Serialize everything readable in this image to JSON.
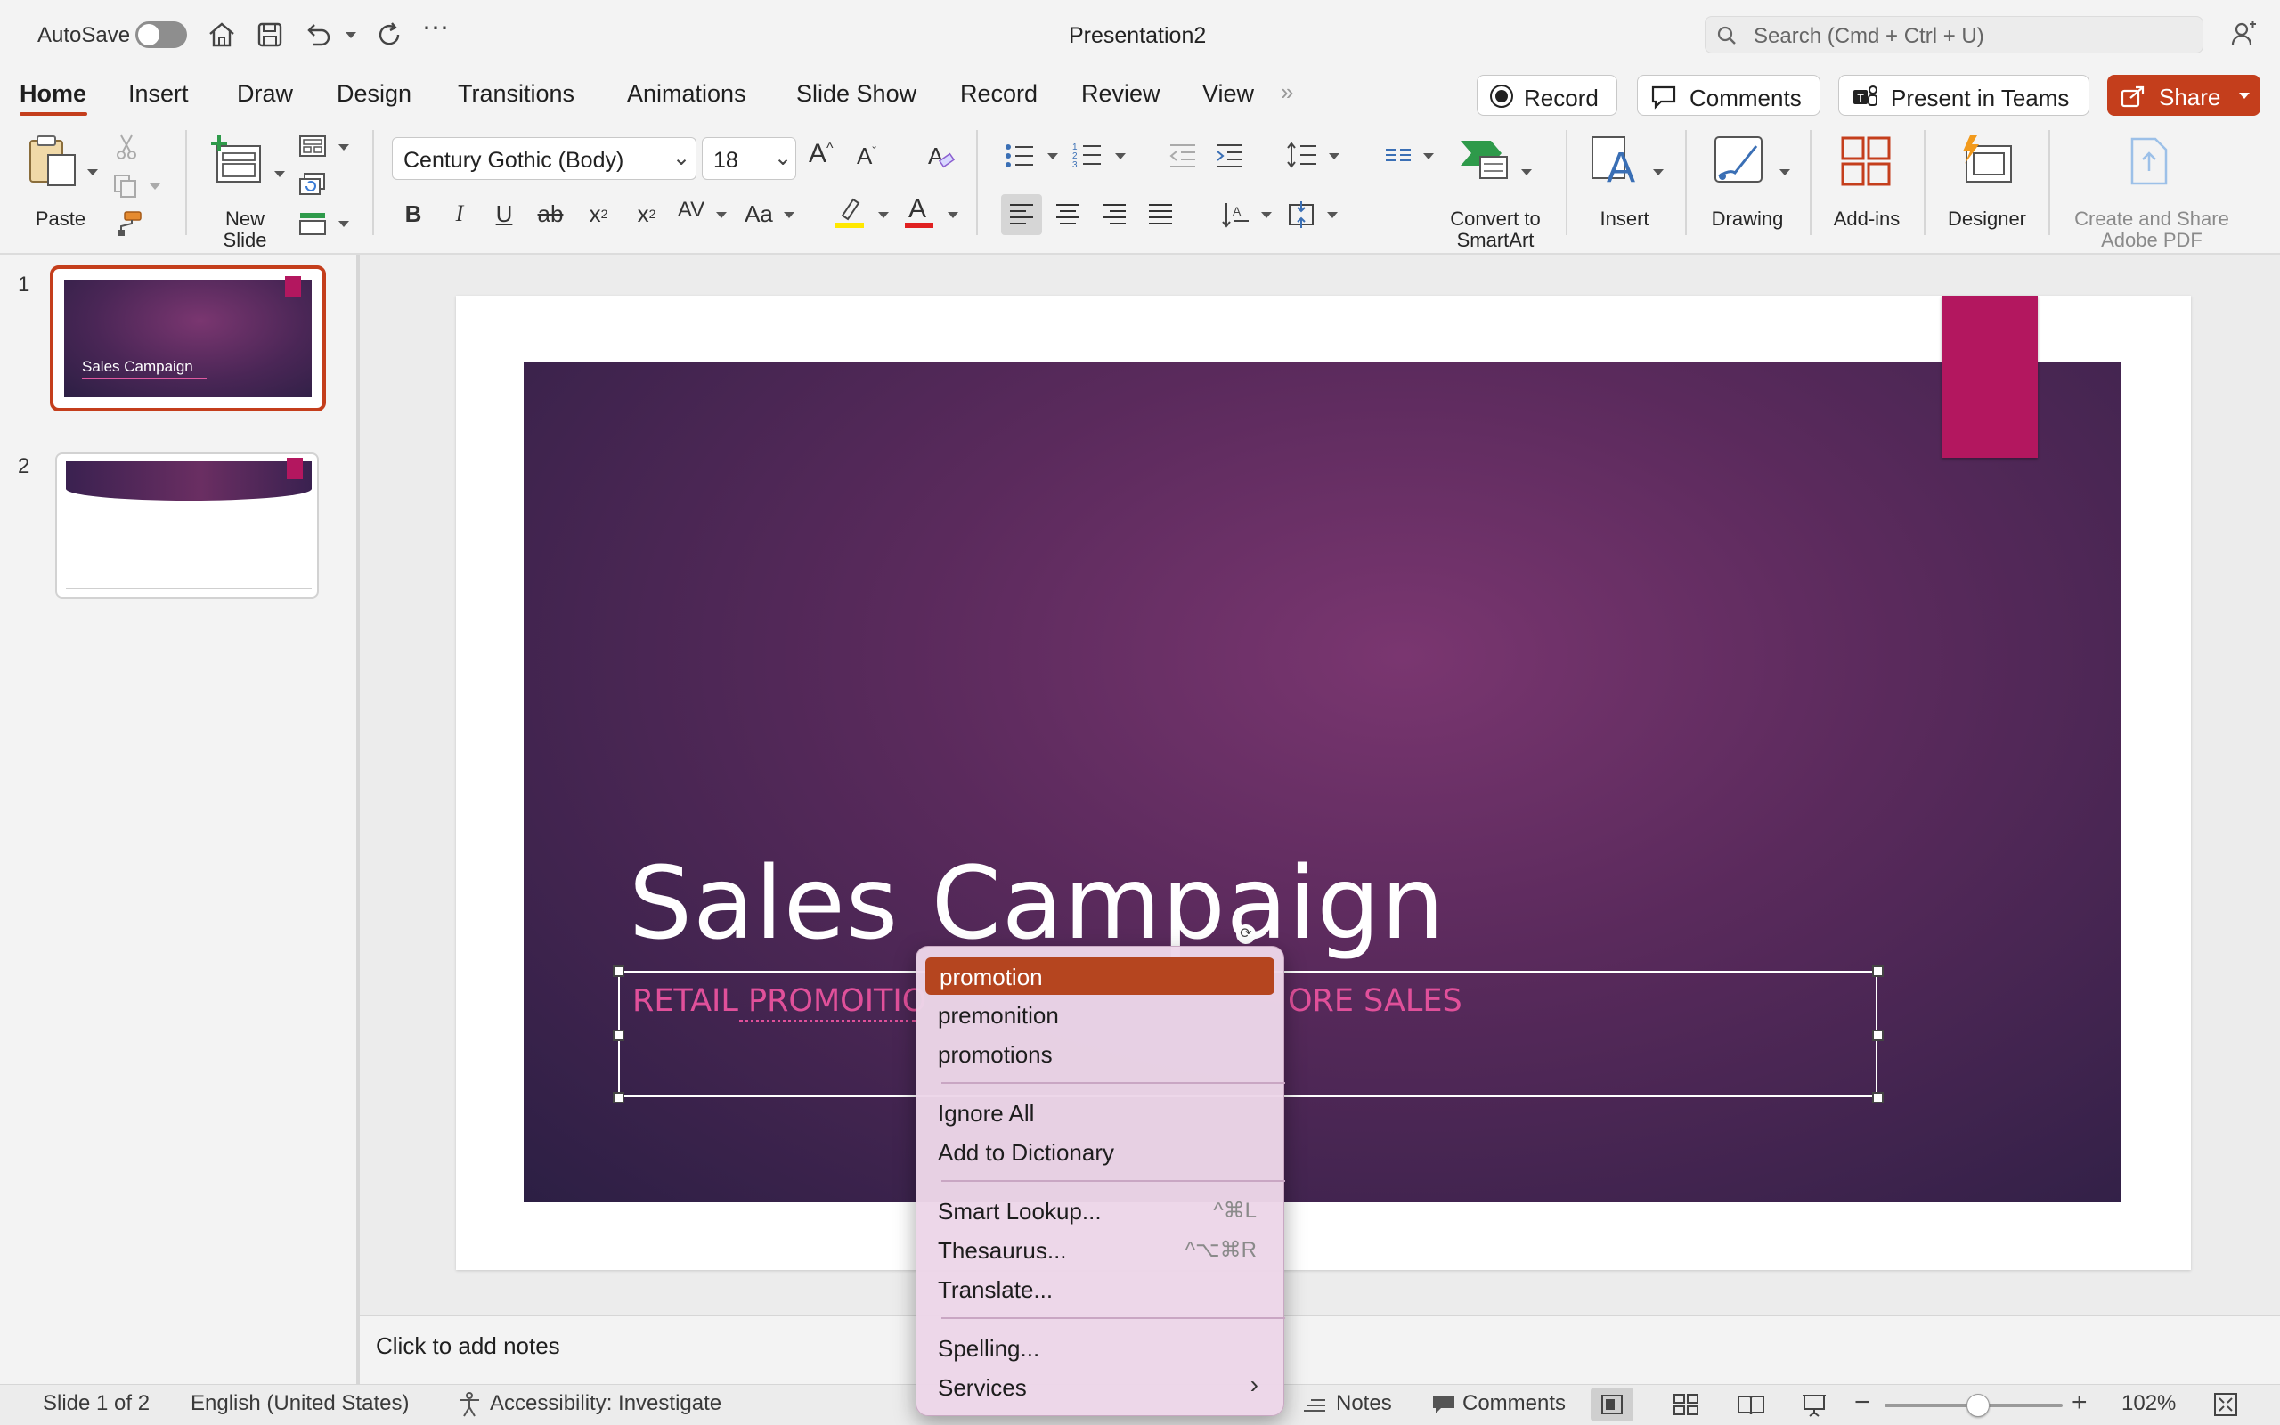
{
  "titlebar": {
    "autosave_label": "AutoSave",
    "document_title": "Presentation2",
    "search_placeholder": "Search (Cmd + Ctrl + U)"
  },
  "tabs": [
    "Home",
    "Insert",
    "Draw",
    "Design",
    "Transitions",
    "Animations",
    "Slide Show",
    "Record",
    "Review",
    "View"
  ],
  "active_tab": "Home",
  "ribbon_buttons": {
    "record": "Record",
    "comments": "Comments",
    "present_in_teams": "Present in Teams",
    "share": "Share"
  },
  "ribbon": {
    "paste": "Paste",
    "new_slide_1": "New",
    "new_slide_2": "Slide",
    "font_name": "Century Gothic (Body)",
    "font_size": "18",
    "convert_1": "Convert to",
    "convert_2": "SmartArt",
    "insert": "Insert",
    "drawing": "Drawing",
    "addins": "Add-ins",
    "designer": "Designer",
    "adobe_1": "Create and Share",
    "adobe_2": "Adobe PDF"
  },
  "thumbnails": [
    {
      "number": "1",
      "title": "Sales Campaign",
      "selected": true
    },
    {
      "number": "2",
      "title": "",
      "selected": false
    }
  ],
  "slide": {
    "title": "Sales Campaign",
    "subtitle_left": "RETAIL PROMOITIO",
    "subtitle_right": "ORE SALES",
    "bg_color": "#5a2a5c",
    "accent_color": "#b3175f"
  },
  "notes_placeholder": "Click to add notes",
  "context_menu": {
    "suggestions": [
      "promotion",
      "premonition",
      "promotions"
    ],
    "ignore_all": "Ignore All",
    "add_to_dictionary": "Add to Dictionary",
    "smart_lookup": "Smart Lookup...",
    "smart_lookup_shortcut": "^⌘L",
    "thesaurus": "Thesaurus...",
    "thesaurus_shortcut": "^⌥⌘R",
    "translate": "Translate...",
    "spelling": "Spelling...",
    "services": "Services"
  },
  "statusbar": {
    "slide_count": "Slide 1 of 2",
    "language": "English (United States)",
    "accessibility": "Accessibility: Investigate",
    "notes": "Notes",
    "comments": "Comments",
    "zoom": "102%"
  },
  "colors": {
    "accent": "#c43e1c",
    "share_bg": "#c43e1c",
    "menu_highlight": "#b5451f"
  }
}
